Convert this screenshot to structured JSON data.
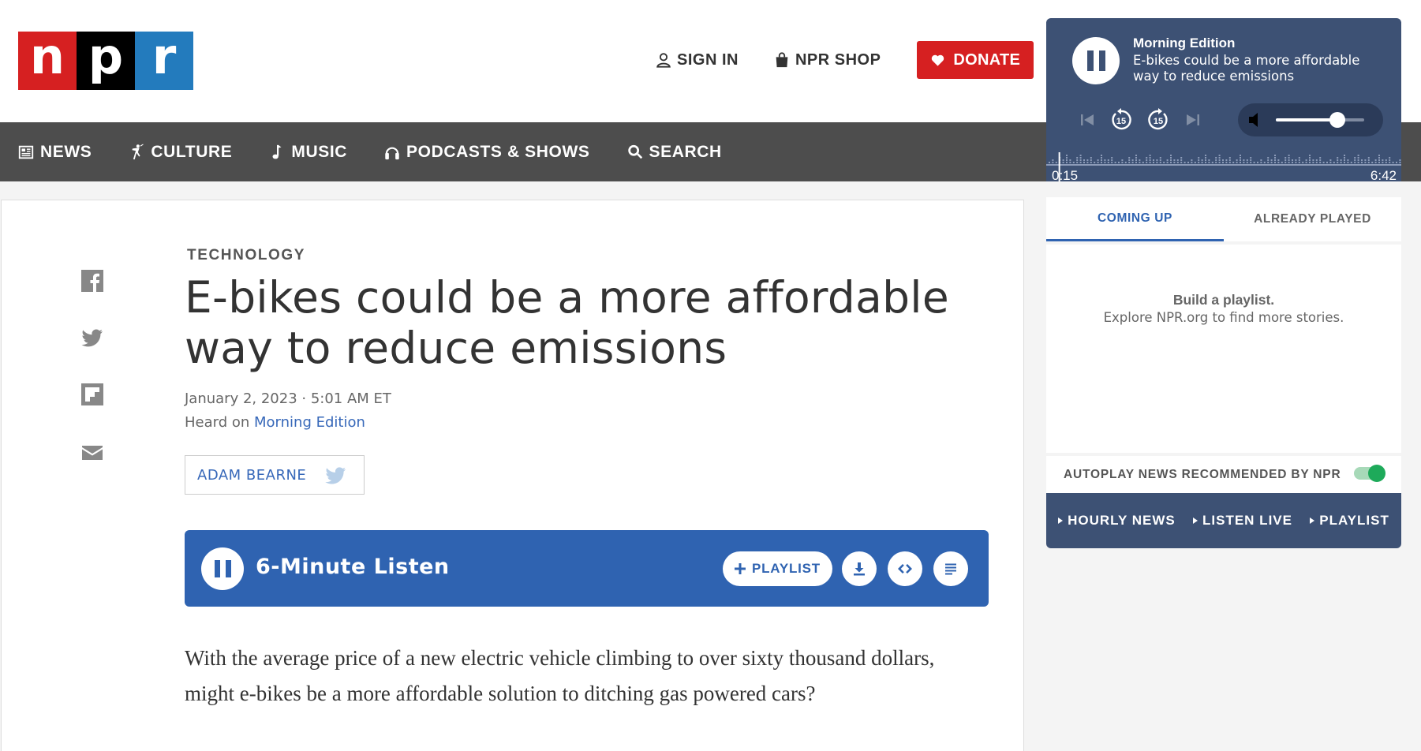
{
  "header": {
    "logo_letters": [
      "n",
      "p",
      "r"
    ],
    "sign_in": "SIGN IN",
    "shop": "NPR SHOP",
    "donate": "DONATE"
  },
  "nav": {
    "items": [
      {
        "label": "NEWS",
        "icon": "news-icon"
      },
      {
        "label": "CULTURE",
        "icon": "culture-icon"
      },
      {
        "label": "MUSIC",
        "icon": "music-note-icon"
      },
      {
        "label": "PODCASTS & SHOWS",
        "icon": "headphones-icon"
      },
      {
        "label": "SEARCH",
        "icon": "search-icon"
      }
    ]
  },
  "share": [
    "facebook-icon",
    "twitter-icon",
    "flipboard-icon",
    "email-icon"
  ],
  "article": {
    "slug": "TECHNOLOGY",
    "title": "E-bikes could be a more affordable way to reduce emissions",
    "date": "January 2, 2023 · 5:01 AM ET",
    "heard_prefix": "Heard on ",
    "heard_show": "Morning Edition",
    "byline": "ADAM BEARNE",
    "teaser": "With the average price of a new electric vehicle climbing to over sixty thousand dollars, might e-bikes be a more affordable solution to ditching gas powered cars?"
  },
  "listen_bar": {
    "title": "6-Minute Listen",
    "playlist": "PLAYLIST"
  },
  "player": {
    "show": "Morning Edition",
    "story": "E-bikes could be a more affordable way to reduce emissions",
    "current_time": "0:15",
    "duration": "6:42",
    "progress": 0.037,
    "volume": 0.7,
    "skip_label": "15"
  },
  "queue": {
    "tabs": [
      "COMING UP",
      "ALREADY PLAYED"
    ],
    "heading": "Build a playlist.",
    "subtext": "Explore NPR.org to find more stories.",
    "autoplay": "AUTOPLAY NEWS RECOMMENDED BY NPR",
    "autoplay_on": true
  },
  "bottom_links": [
    "HOURLY NEWS",
    "LISTEN LIVE",
    "PLAYLIST"
  ],
  "colors": {
    "npr_red": "#d62021",
    "npr_blue": "#237bbd",
    "nav_bg": "#4d4d4d",
    "listen_blue": "#2f63b1",
    "player_bg": "#3d5174",
    "toggle_green": "#1eaa5a"
  }
}
